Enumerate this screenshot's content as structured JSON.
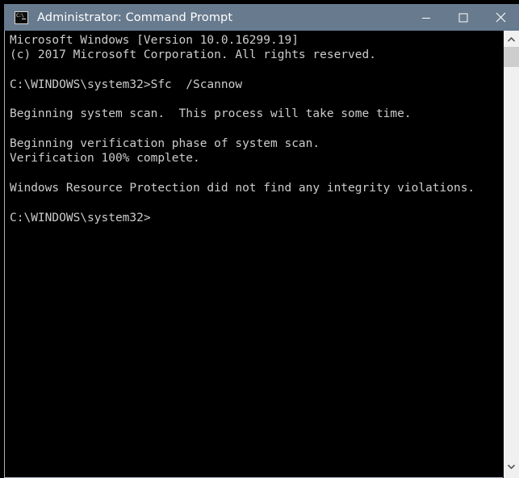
{
  "window": {
    "title": "Administrator: Command Prompt",
    "icon": "command-prompt-icon",
    "icon_glyph": "C:\\",
    "titlebar_color": "#677a8e",
    "console_bg": "#000000",
    "console_fg": "#cccccc"
  },
  "titlebar_controls": {
    "minimize_label": "Minimize",
    "maximize_label": "Maximize",
    "close_label": "Close"
  },
  "console": {
    "lines": [
      "Microsoft Windows [Version 10.0.16299.19]",
      "(c) 2017 Microsoft Corporation. All rights reserved.",
      "",
      "C:\\WINDOWS\\system32>Sfc  /Scannow",
      "",
      "Beginning system scan.  This process will take some time.",
      "",
      "Beginning verification phase of system scan.",
      "Verification 100% complete.",
      "",
      "Windows Resource Protection did not find any integrity violations.",
      "",
      "C:\\WINDOWS\\system32>"
    ],
    "command": "Sfc  /Scannow",
    "prompt": "C:\\WINDOWS\\system32>",
    "version": "10.0.16299.19",
    "copyright_year": "2017",
    "verification_percent": "100%"
  },
  "scrollbar": {
    "up_arrow": "chevron-up-icon",
    "down_arrow": "chevron-down-icon",
    "thumb_color": "#cdcdcd",
    "track_color": "#f0f0f0"
  }
}
